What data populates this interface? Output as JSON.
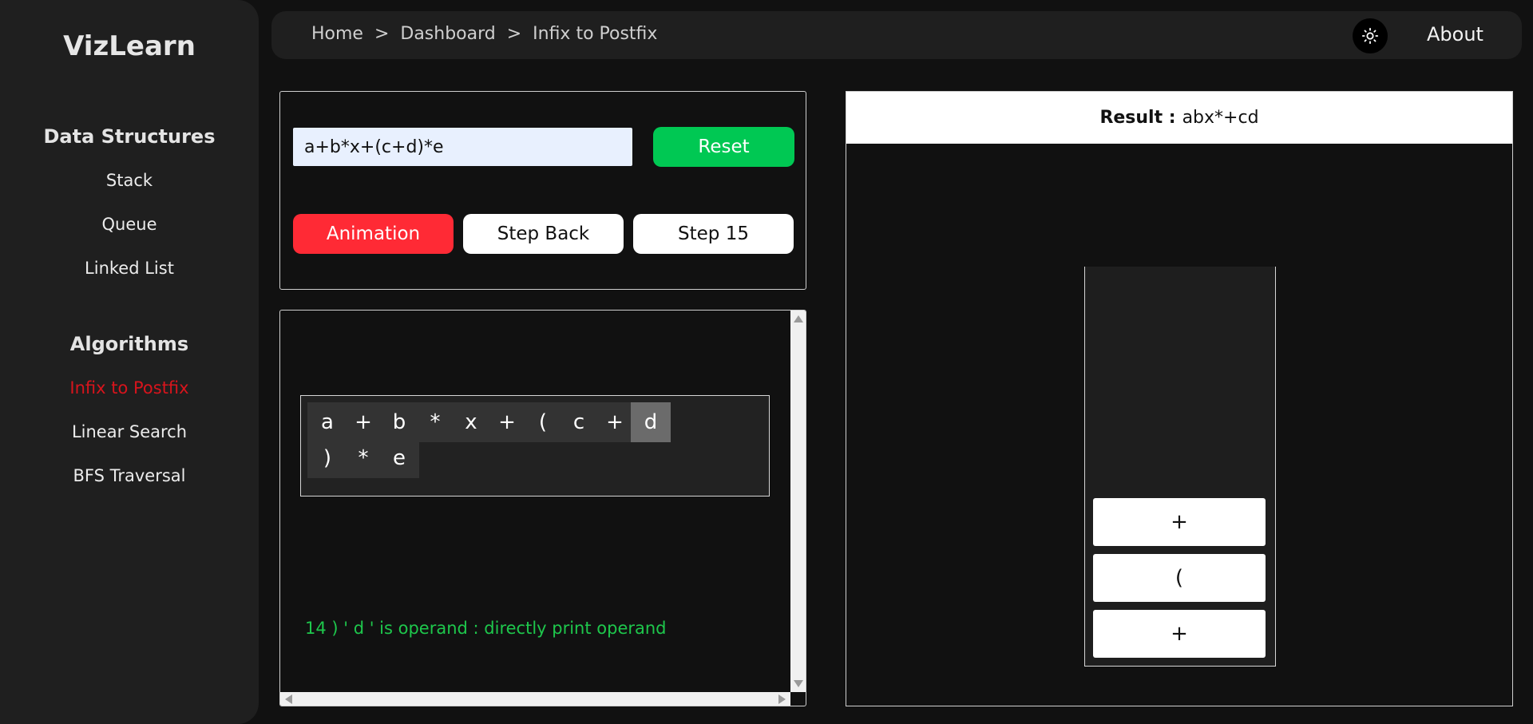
{
  "sidebar": {
    "brand": "VizLearn",
    "data_structures_title": "Data Structures",
    "data_structures": [
      "Stack",
      "Queue",
      "Linked List"
    ],
    "algorithms_title": "Algorithms",
    "algorithms": [
      "Infix to Postfix",
      "Linear Search",
      "BFS Traversal"
    ],
    "active_item": "Infix to Postfix"
  },
  "topbar": {
    "breadcrumb": [
      "Home",
      "Dashboard",
      "Infix to Postfix"
    ],
    "separator": ">",
    "theme_icon": "sun-icon",
    "about_label": "About"
  },
  "controls": {
    "expression_value": "a+b*x+(c+d)*e",
    "reset_label": "Reset",
    "animation_label": "Animation",
    "step_back_label": "Step Back",
    "step_label": "Step 15"
  },
  "tokens": {
    "items": [
      "a",
      "+",
      "b",
      "*",
      "x",
      "+",
      "(",
      "c",
      "+",
      "d",
      ")",
      "*",
      "e"
    ],
    "current_index": 9
  },
  "step_message": "14 ) ' d ' is operand : directly print operand",
  "result": {
    "label": "Result :",
    "value": "abx*+cd"
  },
  "stack": {
    "items_top_to_bottom": [
      "+",
      "(",
      "+"
    ]
  },
  "colors": {
    "background": "#111111",
    "panel": "#1f1f1f",
    "active_nav": "#d8141c",
    "reset": "#00c853",
    "animation": "#ff2a35",
    "message": "#1ec74c",
    "current_token": "#6b6b6b"
  }
}
